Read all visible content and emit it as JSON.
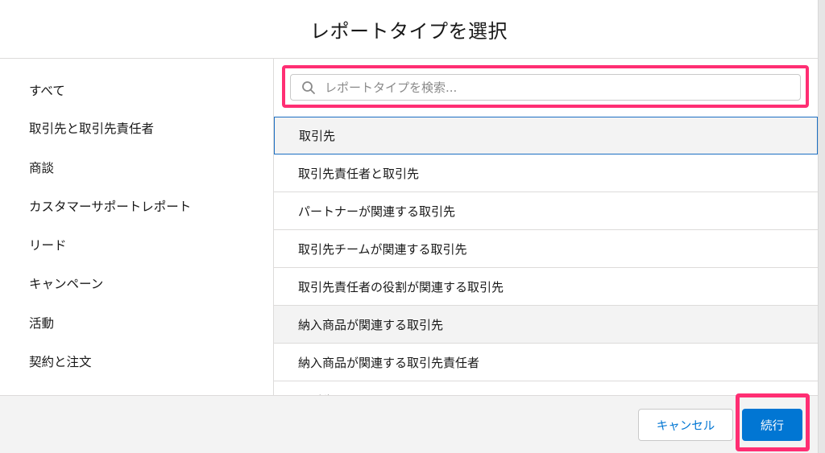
{
  "modal": {
    "title": "レポートタイプを選択"
  },
  "sidebar": {
    "items": [
      {
        "label": "すべて"
      },
      {
        "label": "取引先と取引先責任者"
      },
      {
        "label": "商談"
      },
      {
        "label": "カスタマーサポートレポート"
      },
      {
        "label": "リード"
      },
      {
        "label": "キャンペーン"
      },
      {
        "label": "活動"
      },
      {
        "label": "契約と注文"
      }
    ]
  },
  "search": {
    "placeholder": "レポートタイプを検索...",
    "value": ""
  },
  "report_types": {
    "items": [
      {
        "label": "取引先"
      },
      {
        "label": "取引先責任者と取引先"
      },
      {
        "label": "パートナーが関連する取引先"
      },
      {
        "label": "取引先チームが関連する取引先"
      },
      {
        "label": "取引先責任者の役割が関連する取引先"
      },
      {
        "label": "納入商品が関連する取引先"
      },
      {
        "label": "納入商品が関連する取引先責任者"
      },
      {
        "label": "取引先履歴"
      }
    ]
  },
  "footer": {
    "cancel_label": "キャンセル",
    "next_label": "続行"
  },
  "colors": {
    "accent": "#0176d3",
    "highlight": "#ff2e73",
    "selected_border": "#1b6ec2"
  }
}
